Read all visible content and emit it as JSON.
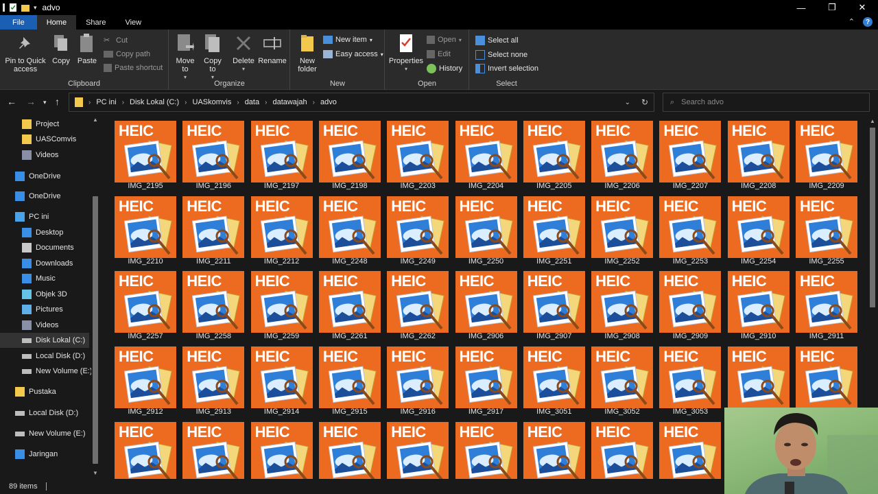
{
  "window": {
    "title": "advo"
  },
  "ribbon_tabs": [
    {
      "label": "File"
    },
    {
      "label": "Home"
    },
    {
      "label": "Share"
    },
    {
      "label": "View"
    }
  ],
  "ribbon": {
    "clipboard": {
      "label": "Clipboard",
      "pin": "Pin to Quick access",
      "copy": "Copy",
      "paste": "Paste",
      "cut": "Cut",
      "copy_path": "Copy path",
      "paste_shortcut": "Paste shortcut"
    },
    "organize": {
      "label": "Organize",
      "move_to": "Move to",
      "copy_to": "Copy to",
      "delete": "Delete",
      "rename": "Rename"
    },
    "new": {
      "label": "New",
      "new_folder": "New folder",
      "new_item": "New item",
      "easy_access": "Easy access"
    },
    "open": {
      "label": "Open",
      "properties": "Properties",
      "open": "Open",
      "edit": "Edit",
      "history": "History"
    },
    "select": {
      "label": "Select",
      "select_all": "Select all",
      "select_none": "Select none",
      "invert": "Invert selection"
    }
  },
  "breadcrumb": [
    "PC ini",
    "Disk Lokal (C:)",
    "UASkomvis",
    "data",
    "datawajah",
    "advo"
  ],
  "search": {
    "placeholder": "Search advo"
  },
  "sidebar": {
    "items": [
      {
        "label": "Project",
        "icon": "folder-icon",
        "indent": 1
      },
      {
        "label": "UASComvis",
        "icon": "folder-icon",
        "indent": 1
      },
      {
        "label": "Videos",
        "icon": "videos-icon",
        "indent": 1
      },
      {
        "label": "OneDrive",
        "icon": "cloud-icon",
        "indent": 0
      },
      {
        "label": "OneDrive",
        "icon": "cloud-icon",
        "indent": 0
      },
      {
        "label": "PC ini",
        "icon": "pc-icon",
        "indent": 0
      },
      {
        "label": "Desktop",
        "icon": "desktop-icon",
        "indent": 1
      },
      {
        "label": "Documents",
        "icon": "documents-icon",
        "indent": 1
      },
      {
        "label": "Downloads",
        "icon": "downloads-icon",
        "indent": 1
      },
      {
        "label": "Music",
        "icon": "music-icon",
        "indent": 1
      },
      {
        "label": "Objek 3D",
        "icon": "objects-3d-icon",
        "indent": 1
      },
      {
        "label": "Pictures",
        "icon": "pictures-icon",
        "indent": 1
      },
      {
        "label": "Videos",
        "icon": "videos-icon",
        "indent": 1
      },
      {
        "label": "Disk Lokal (C:)",
        "icon": "drive-icon",
        "indent": 1,
        "selected": true
      },
      {
        "label": "Local Disk (D:)",
        "icon": "drive-icon",
        "indent": 1
      },
      {
        "label": "New Volume (E:)",
        "icon": "drive-icon",
        "indent": 1
      },
      {
        "label": "Pustaka",
        "icon": "folder-icon",
        "indent": 0
      },
      {
        "label": "Local Disk (D:)",
        "icon": "drive-icon",
        "indent": 0
      },
      {
        "label": "New Volume (E:)",
        "icon": "drive-icon",
        "indent": 0
      },
      {
        "label": "Jaringan",
        "icon": "network-icon",
        "indent": 0
      }
    ]
  },
  "files": {
    "badge": "HEIC",
    "names": [
      "IMG_2195",
      "IMG_2196",
      "IMG_2197",
      "IMG_2198",
      "IMG_2203",
      "IMG_2204",
      "IMG_2205",
      "IMG_2206",
      "IMG_2207",
      "IMG_2208",
      "IMG_2209",
      "IMG_2210",
      "IMG_2211",
      "IMG_2212",
      "IMG_2248",
      "IMG_2249",
      "IMG_2250",
      "IMG_2251",
      "IMG_2252",
      "IMG_2253",
      "IMG_2254",
      "IMG_2255",
      "IMG_2257",
      "IMG_2258",
      "IMG_2259",
      "IMG_2261",
      "IMG_2262",
      "IMG_2906",
      "IMG_2907",
      "IMG_2908",
      "IMG_2909",
      "IMG_2910",
      "IMG_2911",
      "IMG_2912",
      "IMG_2913",
      "IMG_2914",
      "IMG_2915",
      "IMG_2916",
      "IMG_2917",
      "IMG_3051",
      "IMG_3052",
      "IMG_3053",
      "",
      ""
    ],
    "partial_row_count": 9
  },
  "status": {
    "item_count": "89 items"
  },
  "colors": {
    "tile_orange": "#ec6b21",
    "accent_blue": "#1a5fb4",
    "background": "#191919",
    "ribbon": "#2b2b2b"
  }
}
